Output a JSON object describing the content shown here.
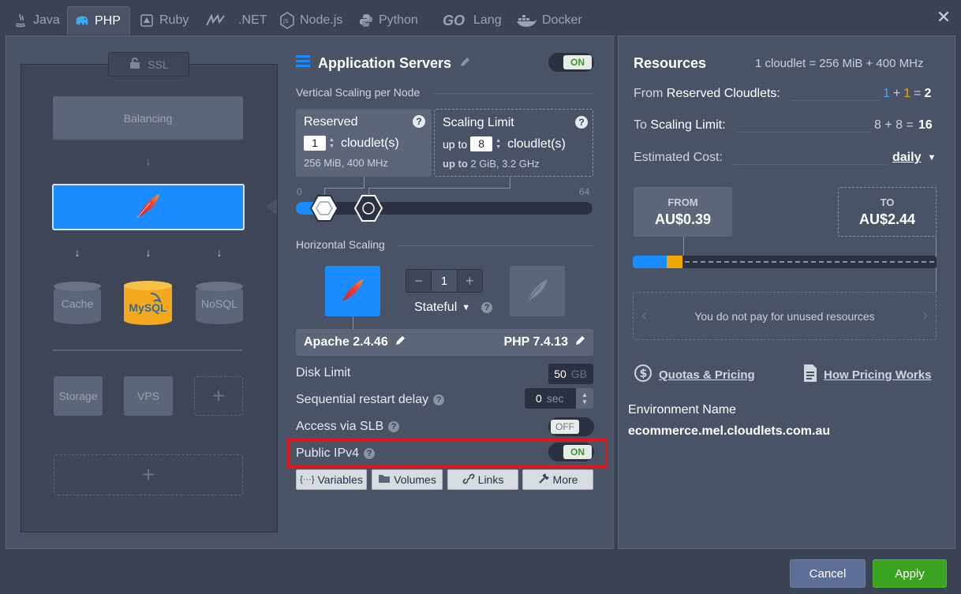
{
  "tabs": [
    {
      "label": "Java",
      "icon": "java-icon"
    },
    {
      "label": "PHP",
      "icon": "php-icon"
    },
    {
      "label": "Ruby",
      "icon": "ruby-icon"
    },
    {
      "label": ".NET",
      "icon": "dotnet-icon"
    },
    {
      "label": "Node.js",
      "icon": "nodejs-icon"
    },
    {
      "label": "Python",
      "icon": "python-icon"
    },
    {
      "label": "Lang",
      "icon": "go-lang-icon"
    },
    {
      "label": "Docker",
      "icon": "docker-icon"
    }
  ],
  "go_logo": "GO",
  "topology": {
    "ssl_label": "SSL",
    "balancing_label": "Balancing",
    "cache_label": "Cache",
    "nosql_label": "NoSQL",
    "mysql_label": "MySQL",
    "storage_label": "Storage",
    "vps_label": "VPS",
    "plus": "+"
  },
  "app_servers": {
    "title": "Application Servers",
    "toggle": "ON",
    "vertical_label": "Vertical Scaling per Node",
    "reserved": {
      "title": "Reserved",
      "value": "1",
      "unit": "cloudlet(s)",
      "meta": "256 MiB, 400 MHz"
    },
    "limit": {
      "title": "Scaling Limit",
      "prefix": "up to",
      "value": "8",
      "unit": "cloudlet(s)",
      "meta_prefix": "up to",
      "meta": "2 GiB, 3.2 GHz"
    },
    "slider_min": "0",
    "slider_max": "64",
    "slider_reserved": 1,
    "slider_limit": 8,
    "horizontal_label": "Horizontal Scaling",
    "node_count": "1",
    "minus": "−",
    "plus": "+",
    "stateful": "Stateful",
    "qmark": "?",
    "apache": "Apache 2.4.46",
    "php": "PHP 7.4.13",
    "disk_label": "Disk Limit",
    "disk_value": "50",
    "disk_unit": "GB",
    "restart_label": "Sequential restart delay",
    "restart_value": "0",
    "restart_unit": "sec",
    "slb_label": "Access via SLB",
    "slb_toggle": "OFF",
    "ipv4_label": "Public IPv4",
    "ipv4_toggle": "ON",
    "buttons": {
      "variables": "Variables",
      "volumes": "Volumes",
      "links": "Links",
      "more": "More"
    },
    "variables_icon": "{···}"
  },
  "resources": {
    "title": "Resources",
    "cloudlet_info": "1 cloudlet = 256 MiB + 400 MHz",
    "from_prefix": "From",
    "from_label": "Reserved Cloudlets:",
    "reserved_a": "1",
    "reserved_plus": "+",
    "reserved_b": "1",
    "reserved_eq": "=",
    "reserved_total": "2",
    "to_prefix": "To",
    "to_label": "Scaling Limit:",
    "limit_expr": "8 + 8 =",
    "limit_total": "16",
    "cost_label": "Estimated Cost:",
    "period": "daily",
    "from_cap": "FROM",
    "from_val": "AU$0.39",
    "to_cap": "TO",
    "to_val": "AU$2.44",
    "note": "You do not pay for unused resources",
    "quotas_link": "Quotas & Pricing",
    "pricing_link": "How Pricing Works",
    "env_label": "Environment Name",
    "env_name": "ecommerce.mel.cloudlets.com.au"
  },
  "footer": {
    "cancel": "Cancel",
    "apply": "Apply"
  },
  "colors": {
    "accent_blue": "#1b8cff",
    "apply_green": "#3aa31f",
    "toggle_on": "#3a9d23",
    "highlight_red": "#e8141c",
    "reserved_orange": "#f0a800"
  }
}
